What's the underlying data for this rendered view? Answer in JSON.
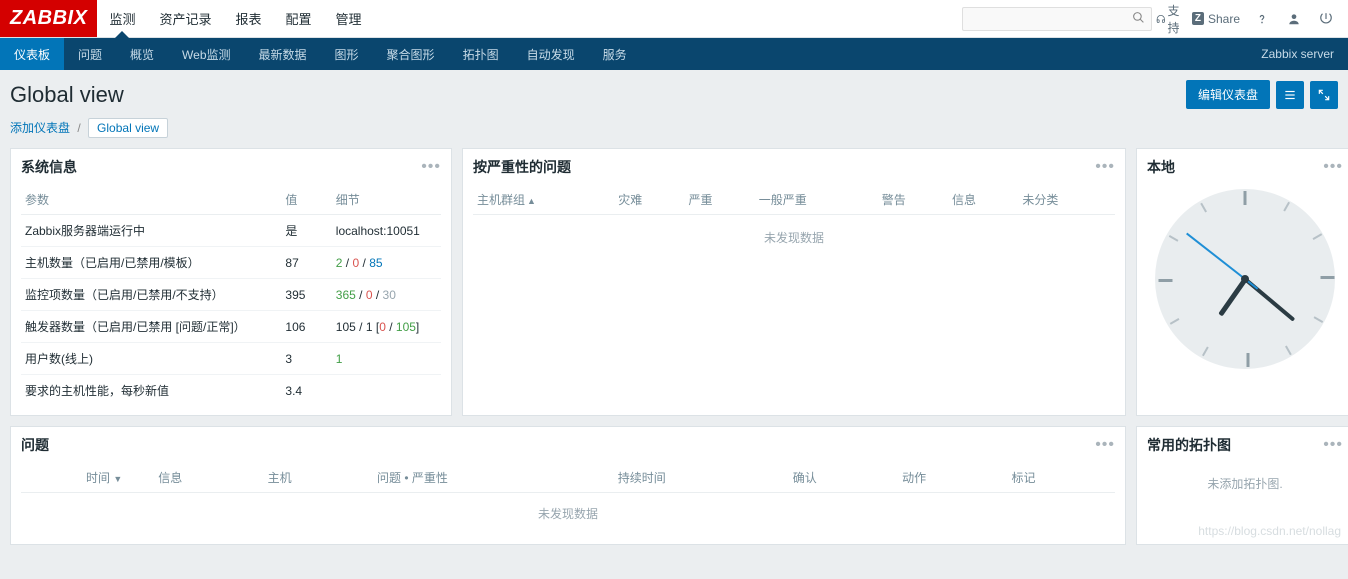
{
  "logo": "ZABBIX",
  "topnav": [
    "监测",
    "资产记录",
    "报表",
    "配置",
    "管理"
  ],
  "topnav_active": 0,
  "support_label": "支持",
  "share_label": "Share",
  "search_placeholder": "",
  "subnav": [
    "仪表板",
    "问题",
    "概览",
    "Web监测",
    "最新数据",
    "图形",
    "聚合图形",
    "拓扑图",
    "自动发现",
    "服务"
  ],
  "subnav_active": 0,
  "server_label": "Zabbix server",
  "page_title": "Global view",
  "edit_btn": "编辑仪表盘",
  "breadcrumb": {
    "link": "添加仪表盘",
    "current": "Global view"
  },
  "sysinfo": {
    "title": "系统信息",
    "cols": [
      "参数",
      "值",
      "细节"
    ],
    "rows": [
      {
        "param": "Zabbix服务器端运行中",
        "value": "是",
        "value_cls": "v-green",
        "detail_plain": "localhost:10051"
      },
      {
        "param": "主机数量（已启用/已禁用/模板）",
        "value": "87",
        "detail_parts": [
          {
            "t": "2",
            "cls": "v-green"
          },
          {
            "t": " / "
          },
          {
            "t": "0",
            "cls": "v-red"
          },
          {
            "t": " / "
          },
          {
            "t": "85",
            "cls": "v-link"
          }
        ]
      },
      {
        "param": "监控项数量（已启用/已禁用/不支持）",
        "value": "395",
        "detail_parts": [
          {
            "t": "365",
            "cls": "v-green"
          },
          {
            "t": " / "
          },
          {
            "t": "0",
            "cls": "v-red"
          },
          {
            "t": " / "
          },
          {
            "t": "30",
            "cls": "v-gray"
          }
        ]
      },
      {
        "param": "触发器数量（已启用/已禁用 [问题/正常]）",
        "value": "106",
        "detail_parts": [
          {
            "t": "105"
          },
          {
            "t": " / "
          },
          {
            "t": "1"
          },
          {
            "t": " ["
          },
          {
            "t": "0",
            "cls": "v-red"
          },
          {
            "t": " / "
          },
          {
            "t": "105",
            "cls": "v-green"
          },
          {
            "t": "]"
          }
        ]
      },
      {
        "param": "用户数(线上)",
        "value": "3",
        "detail_parts": [
          {
            "t": "1",
            "cls": "v-green"
          }
        ]
      },
      {
        "param": "要求的主机性能，每秒新值",
        "value": "3.4",
        "detail_plain": ""
      }
    ]
  },
  "severity": {
    "title": "按严重性的问题",
    "cols": [
      "主机群组",
      "灾难",
      "严重",
      "一般严重",
      "警告",
      "信息",
      "未分类"
    ],
    "empty": "未发现数据"
  },
  "clock": {
    "title": "本地"
  },
  "problems": {
    "title": "问题",
    "cols": [
      "时间",
      "信息",
      "主机",
      "问题 • 严重性",
      "持续时间",
      "确认",
      "动作",
      "标记"
    ],
    "empty": "未发现数据"
  },
  "maps": {
    "title": "常用的拓扑图",
    "empty": "未添加拓扑图."
  },
  "watermark": "https://blog.csdn.net/nollag"
}
